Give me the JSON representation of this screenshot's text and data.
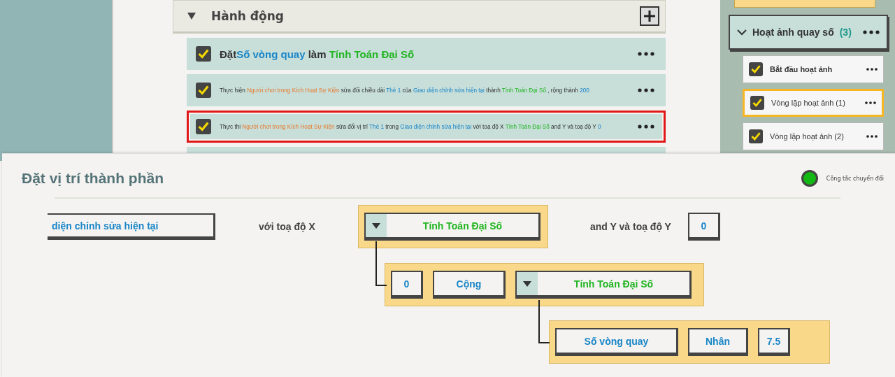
{
  "actions": {
    "title": "Hành động",
    "expanded": true,
    "rows": [
      {
        "checked": true,
        "selected": false,
        "kind": "headline",
        "segments": [
          {
            "kind": "plain",
            "text": "Đặt"
          },
          {
            "kind": "object",
            "text": "Số vòng quay"
          },
          {
            "kind": "plain",
            "text": " làm "
          },
          {
            "kind": "calc",
            "text": "Tính Toán Đại Số"
          }
        ]
      },
      {
        "checked": true,
        "selected": false,
        "kind": "detail",
        "segments": [
          {
            "kind": "plain",
            "text": "Thực hiện "
          },
          {
            "kind": "player",
            "text": "Người chơi trong Kích Hoạt Sự Kiện"
          },
          {
            "kind": "plain",
            "text": " sửa đổi chiều dài "
          },
          {
            "kind": "object",
            "text": "Thẻ 1"
          },
          {
            "kind": "plain",
            "text": " của "
          },
          {
            "kind": "object",
            "text": "Giao diện chỉnh sửa hiện tại"
          },
          {
            "kind": "plain",
            "text": " thành "
          },
          {
            "kind": "calc",
            "text": "Tính Toán Đại Số"
          },
          {
            "kind": "plain",
            "text": " ,  rộng thành "
          },
          {
            "kind": "object",
            "text": "200"
          }
        ]
      },
      {
        "checked": true,
        "selected": true,
        "kind": "detail",
        "segments": [
          {
            "kind": "plain",
            "text": "Thực thi "
          },
          {
            "kind": "player",
            "text": "Người chơi trong Kích Hoạt Sự Kiện"
          },
          {
            "kind": "plain",
            "text": " sửa đổi vị trí "
          },
          {
            "kind": "object",
            "text": "Thẻ 1"
          },
          {
            "kind": "plain",
            "text": " trong "
          },
          {
            "kind": "object",
            "text": "Giao diện chỉnh sửa hiện tại"
          },
          {
            "kind": "plain",
            "text": " với toạ độ X "
          },
          {
            "kind": "calc",
            "text": "Tính Toán Đại Số"
          },
          {
            "kind": "plain",
            "text": " and Y và toạ độ Y "
          },
          {
            "kind": "object",
            "text": "0"
          }
        ]
      }
    ]
  },
  "sidebar": {
    "group": {
      "title": "Hoạt ảnh quay số",
      "count": "(3)",
      "expanded": true
    },
    "items": [
      {
        "label": "Bắt đầu hoạt ảnh",
        "checked": true,
        "selected": false,
        "bold": true
      },
      {
        "label": "Vòng lặp hoạt ảnh (1)",
        "checked": true,
        "selected": true,
        "bold": false
      },
      {
        "label": "Vòng lặp hoạt ảnh (2)",
        "checked": true,
        "selected": false,
        "bold": false
      }
    ]
  },
  "dialog": {
    "title": "Đặt vị trí thành phần",
    "toggle": {
      "label": "Công tắc chuyển đổi",
      "on": true
    },
    "params": [
      {
        "kind": "field",
        "text": "diện chỉnh sửa hiện tại"
      },
      {
        "kind": "label",
        "text": "với toạ độ X"
      },
      {
        "kind": "calc",
        "text": "Tính Toán Đại Số",
        "expr": {
          "left": {
            "kind": "value",
            "text": "0"
          },
          "op": "Cộng",
          "right": {
            "kind": "calc",
            "text": "Tính Toán Đại Số",
            "expr": {
              "left": {
                "kind": "variable",
                "text": "Số vòng quay"
              },
              "op": "Nhân",
              "right": {
                "kind": "value",
                "text": "7.5"
              }
            }
          }
        }
      },
      {
        "kind": "label",
        "text": "and Y và toạ độ Y"
      },
      {
        "kind": "value",
        "text": "0"
      }
    ]
  }
}
